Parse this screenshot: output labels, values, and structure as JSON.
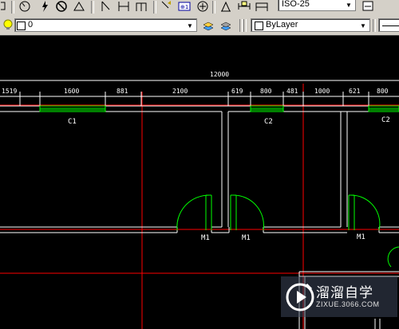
{
  "toolbar": {
    "dimstyle_value": "ISO-25",
    "layer_value": "0",
    "color_value": "ByLayer"
  },
  "drawing": {
    "overall_dimension": "12000",
    "dimensions": [
      "1519",
      "1600",
      "881",
      "2100",
      "619",
      "800",
      "481",
      "1000",
      "621",
      "800"
    ],
    "window_labels": [
      "C1",
      "C2",
      "C2"
    ],
    "door_labels": [
      "M1",
      "M1",
      "M1"
    ]
  },
  "watermark": {
    "brand_cn": "溜溜自学",
    "url": "ZIXUE.3066.COM"
  },
  "colors": {
    "canvas_bg": "#000000",
    "wall_line": "#ffffff",
    "axis_line": "#ff0000",
    "window_green": "#00ff00",
    "toolbar_bg": "#d4d0c8"
  }
}
